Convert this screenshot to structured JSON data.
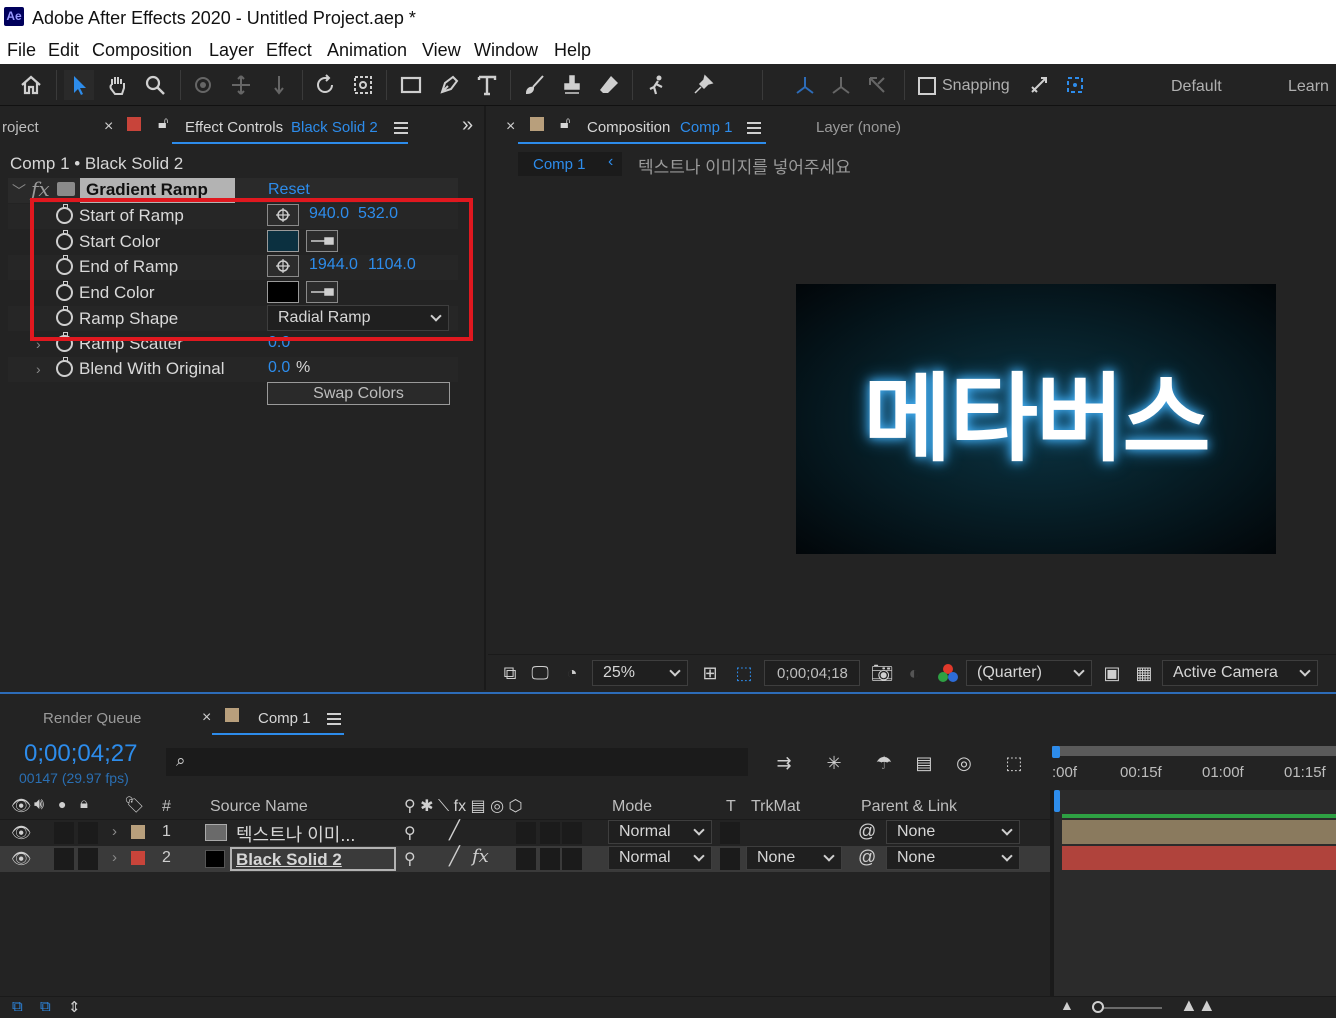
{
  "window": {
    "logo": "Ae",
    "title": "Adobe After Effects 2020 - Untitled Project.aep *"
  },
  "menu": [
    "File",
    "Edit",
    "Composition",
    "Layer",
    "Effect",
    "Animation",
    "View",
    "Window",
    "Help"
  ],
  "toolbar": {
    "snapping_label": "Snapping",
    "workspace_default": "Default",
    "workspace_learn": "Learn"
  },
  "effect_panel": {
    "project_tab": "roject",
    "tab_label": "Effect Controls",
    "tab_layer": "Black Solid 2",
    "breadcrumb": "Comp 1 • Black Solid 2",
    "effect_name": "Gradient Ramp",
    "reset_label": "Reset",
    "fx_label": "fx",
    "properties": {
      "start_of_ramp": {
        "label": "Start of Ramp",
        "x": "940.0",
        "y": "532.0"
      },
      "start_color": {
        "label": "Start Color",
        "color": "#0b3040"
      },
      "end_of_ramp": {
        "label": "End of Ramp",
        "x": "1944.0",
        "y": "1104.0"
      },
      "end_color": {
        "label": "End Color",
        "color": "#000000"
      },
      "ramp_shape": {
        "label": "Ramp Shape",
        "value": "Radial Ramp"
      },
      "ramp_scatter": {
        "label": "Ramp Scatter",
        "value": "0.0"
      },
      "blend": {
        "label": "Blend With Original",
        "value": "0.0",
        "unit": "%"
      }
    },
    "swap_colors_label": "Swap Colors"
  },
  "comp_panel": {
    "tab_label": "Composition",
    "tab_comp": "Comp 1",
    "layer_tab": "Layer (none)",
    "breadcrumb_comp": "Comp 1",
    "breadcrumb_layer": "텍스트나 이미지를 넣어주세요",
    "canvas_text": "메타버스",
    "zoom": "25%",
    "timecode": "0;00;04;18",
    "resolution": "(Quarter)",
    "camera": "Active Camera"
  },
  "timeline": {
    "render_queue": "Render Queue",
    "comp_tab": "Comp 1",
    "current_time": "0;00;04;27",
    "frame_info": "00147 (29.97 fps)",
    "columns": {
      "number": "#",
      "source_name": "Source Name",
      "mode": "Mode",
      "t": "T",
      "trkmat": "TrkMat",
      "parent": "Parent & Link"
    },
    "ruler": [
      ":00f",
      "00:15f",
      "01:00f",
      "01:15f"
    ],
    "layers": [
      {
        "num": "1",
        "name": "텍스트나 이미...",
        "mode": "Normal",
        "trkmat": "",
        "parent": "None",
        "label_color": "#b89f7c"
      },
      {
        "num": "2",
        "name": "Black Solid 2",
        "mode": "Normal",
        "trkmat": "None",
        "parent": "None",
        "label_color": "#c8443a"
      }
    ]
  },
  "colors": {
    "accent_blue": "#2d8ceb",
    "highlight_red": "#e0181f",
    "panel_bg": "#232323"
  }
}
